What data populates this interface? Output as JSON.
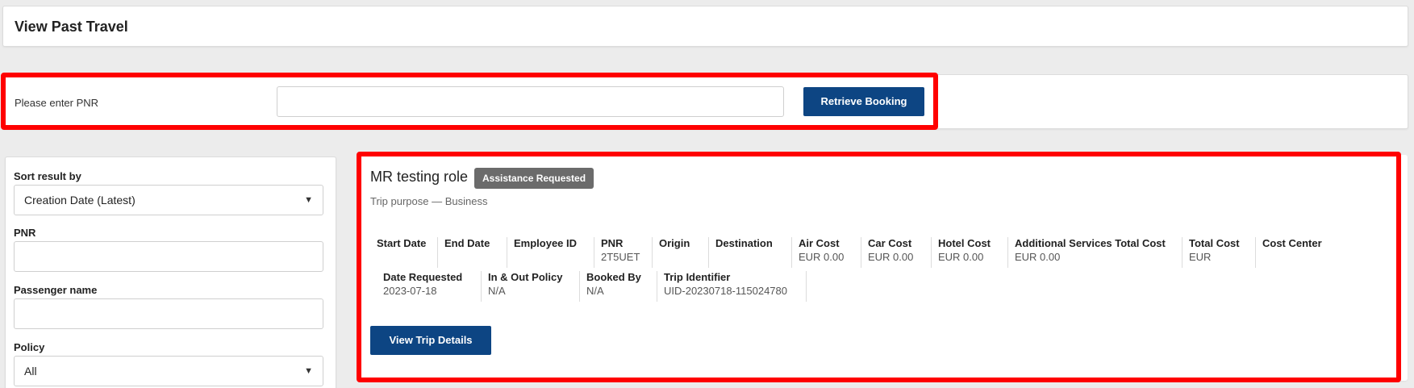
{
  "header": {
    "title": "View Past Travel"
  },
  "pnr_search": {
    "label": "Please enter PNR",
    "input_value": "",
    "button_label": "Retrieve Booking"
  },
  "filters": {
    "sort": {
      "label": "Sort result by",
      "selected": "Creation Date (Latest)"
    },
    "pnr": {
      "label": "PNR",
      "value": ""
    },
    "passenger": {
      "label": "Passenger name",
      "value": ""
    },
    "policy": {
      "label": "Policy",
      "selected": "All"
    }
  },
  "trip": {
    "title": "MR testing role",
    "status": "Assistance Requested",
    "purpose": "Trip purpose — Business",
    "row1": [
      {
        "label": "Start Date",
        "value": ""
      },
      {
        "label": "End Date",
        "value": ""
      },
      {
        "label": "Employee ID",
        "value": ""
      },
      {
        "label": "PNR",
        "value": "2T5UET"
      },
      {
        "label": "Origin",
        "value": ""
      },
      {
        "label": "Destination",
        "value": ""
      },
      {
        "label": "Air Cost",
        "value": "EUR 0.00"
      },
      {
        "label": "Car Cost",
        "value": "EUR 0.00"
      },
      {
        "label": "Hotel Cost",
        "value": "EUR 0.00"
      },
      {
        "label": "Additional Services Total Cost",
        "value": "EUR 0.00"
      },
      {
        "label": "Total Cost",
        "value": "EUR"
      },
      {
        "label": "Cost Center",
        "value": ""
      }
    ],
    "row2": [
      {
        "label": "Date Requested",
        "value": "2023-07-18"
      },
      {
        "label": "In & Out Policy",
        "value": "N/A"
      },
      {
        "label": "Booked By",
        "value": "N/A"
      },
      {
        "label": "Trip Identifier",
        "value": "UID-20230718-115024780"
      }
    ],
    "details_button": "View Trip Details"
  },
  "colors": {
    "primary": "#0d4583",
    "highlight": "#ff0000",
    "badge": "#6b6b6b"
  }
}
